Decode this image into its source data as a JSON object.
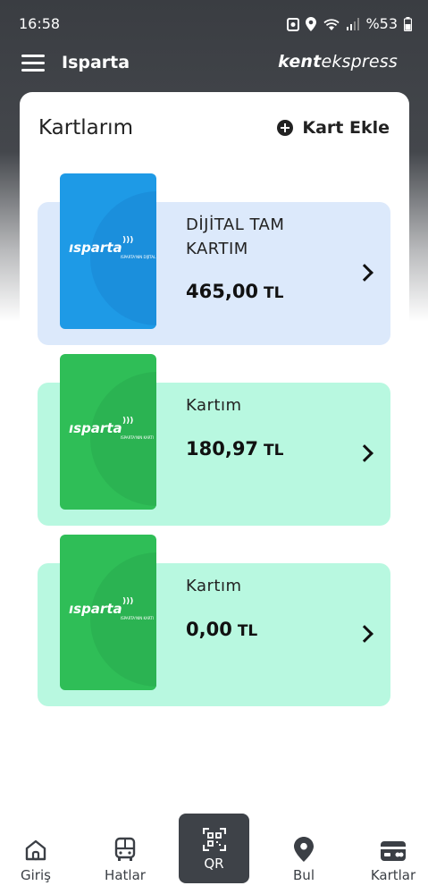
{
  "status_bar": {
    "time": "16:58",
    "battery": "%53"
  },
  "header": {
    "city": "Isparta",
    "brand_bold": "kent",
    "brand_rest": "ekspress"
  },
  "panel": {
    "title": "Kartlarım",
    "add_card_label": "Kart Ekle"
  },
  "cards": [
    {
      "name_line1": "DİJİTAL TAM",
      "name_line2": "KARTIM",
      "balance": "465,00",
      "currency": "TL",
      "card_brand": "ısparta",
      "card_subtext": "ISPARTA'NIN DİJİTAL KARTI",
      "theme": "blue"
    },
    {
      "name_line1": "Kartım",
      "name_line2": "",
      "balance": "180,97",
      "currency": "TL",
      "card_brand": "ısparta",
      "card_subtext": "ISPARTA'NIN KARTI",
      "theme": "green"
    },
    {
      "name_line1": "Kartım",
      "name_line2": "",
      "balance": "0,00",
      "currency": "TL",
      "card_brand": "ısparta",
      "card_subtext": "ISPARTA'NIN KARTI",
      "theme": "green"
    }
  ],
  "bottom_nav": {
    "home": "Giriş",
    "lines": "Hatlar",
    "qr": "QR",
    "find": "Bul",
    "cards": "Kartlar"
  },
  "colors": {
    "header_bg": "#3a3d42",
    "card_blue": "#1e9ae6",
    "card_green": "#2fbe57",
    "row_blue": "#dce9fb",
    "row_green": "#b8f8e0"
  }
}
